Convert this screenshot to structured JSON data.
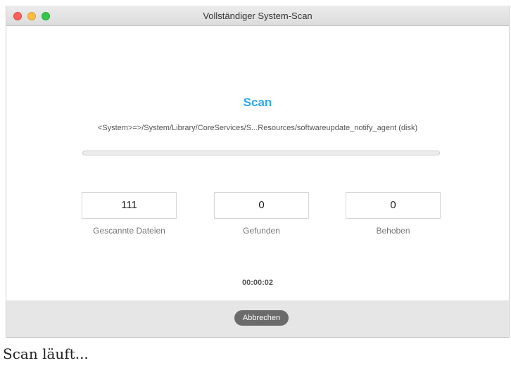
{
  "window": {
    "title": "Vollständiger System-Scan"
  },
  "scan": {
    "heading": "Scan",
    "current_path": "<System>=>/System/Library/CoreServices/S...Resources/softwareupdate_notify_agent (disk)",
    "progress_percent": 0,
    "elapsed": "00:00:02"
  },
  "stats": [
    {
      "value": "111",
      "label": "Gescannte Dateien"
    },
    {
      "value": "0",
      "label": "Gefunden"
    },
    {
      "value": "0",
      "label": "Behoben"
    }
  ],
  "footer": {
    "cancel_label": "Abbrechen"
  },
  "caption": "Scan läuft...",
  "colors": {
    "accent": "#2ea8f0",
    "button": "#6b6b6b"
  }
}
